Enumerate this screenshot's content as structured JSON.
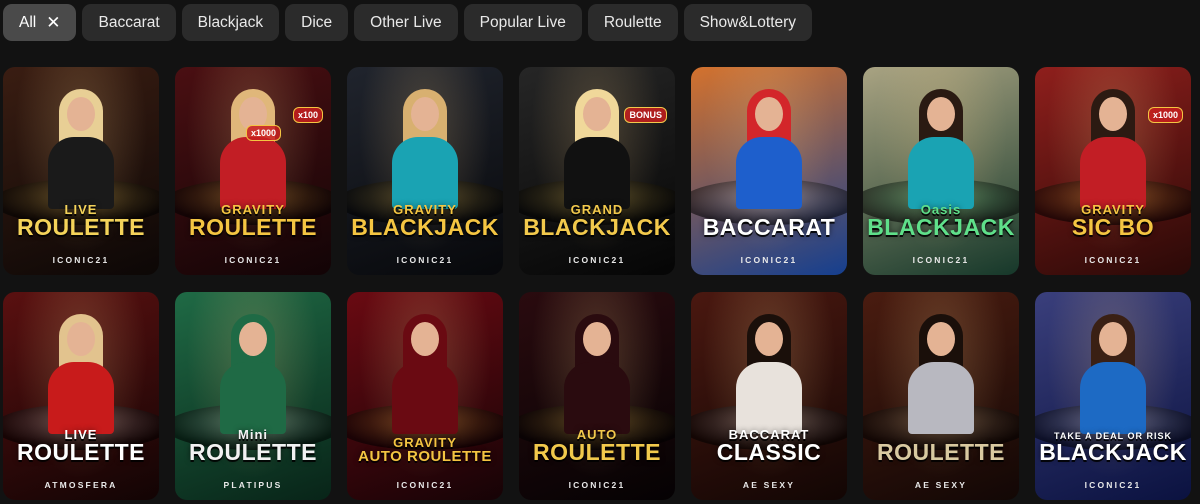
{
  "filters": [
    {
      "label": "All",
      "active": true
    },
    {
      "label": "Baccarat",
      "active": false
    },
    {
      "label": "Blackjack",
      "active": false
    },
    {
      "label": "Dice",
      "active": false
    },
    {
      "label": "Other Live",
      "active": false
    },
    {
      "label": "Popular Live",
      "active": false
    },
    {
      "label": "Roulette",
      "active": false
    },
    {
      "label": "Show&Lottery",
      "active": false
    }
  ],
  "games": [
    {
      "line1": "LIVE",
      "line2": "ROULETTE",
      "provider": "ICONIC21",
      "color1": "#3a1d12",
      "color2": "#0c0706",
      "accent": "#f4d35a",
      "hair": "#e8cf95",
      "body": "#1a1a1a"
    },
    {
      "line1": "GRAVITY",
      "line2": "ROULETTE",
      "provider": "ICONIC21",
      "color1": "#4a0f12",
      "color2": "#120406",
      "accent": "#f4c542",
      "hair": "#e0b77a",
      "body": "#c21e25",
      "badges": [
        "x100",
        "x1000"
      ]
    },
    {
      "line1": "GRAVITY",
      "line2": "BLACKJACK",
      "provider": "ICONIC21",
      "color1": "#20242d",
      "color2": "#07080b",
      "accent": "#f4c542",
      "hair": "#d8b070",
      "body": "#1aa3b3"
    },
    {
      "line1": "GRAND",
      "line2": "BLACKJACK",
      "provider": "ICONIC21",
      "color1": "#262626",
      "color2": "#050505",
      "accent": "#f2c94c",
      "hair": "#f0d89a",
      "body": "#111111",
      "badges": [
        "BONUS"
      ]
    },
    {
      "line1": "",
      "line2": "BACCARAT",
      "provider": "ICONIC21",
      "color1": "#d4722d",
      "color2": "#153f8f",
      "accent": "#ffffff",
      "hair": "#d3262a",
      "body": "#1e5fcc"
    },
    {
      "line1": "Oasis",
      "line2": "BLACKJACK",
      "provider": "ICONIC21",
      "color1": "#a9a382",
      "color2": "#16382a",
      "accent": "#5fe08a",
      "hair": "#2a1a12",
      "body": "#1aa3b3"
    },
    {
      "line1": "GRAVITY",
      "line2": "SIC BO",
      "provider": "ICONIC21",
      "color1": "#8f1f1c",
      "color2": "#2a0907",
      "accent": "#f4c542",
      "hair": "#2c1a12",
      "body": "#c21e25",
      "badges": [
        "x1000"
      ]
    },
    {
      "line1": "LIVE",
      "line2": "ROULETTE",
      "provider": "ATMOSFERA",
      "color1": "#5a1010",
      "color2": "#120404",
      "accent": "#ffffff",
      "hair": "#e2c38e",
      "body": "#c81b1b"
    },
    {
      "line1": "Mini",
      "line2": "ROULETTE",
      "provider": "PLATIPUS",
      "color1": "#1f6a45",
      "color2": "#082418",
      "accent": "#f2f2f2",
      "hair": "#1f6a45",
      "body": "#1f6a45"
    },
    {
      "line1": "GRAVITY",
      "line2": "AUTO ROULETTE",
      "provider": "ICONIC21",
      "color1": "#6a0a12",
      "color2": "#160306",
      "accent": "#f4c542",
      "hair": "#6a0a12",
      "body": "#6a0a12"
    },
    {
      "line1": "AUTO",
      "line2": "ROULETTE",
      "provider": "ICONIC21",
      "color1": "#2a0b0f",
      "color2": "#050203",
      "accent": "#f2c94c",
      "hair": "#2a0b0f",
      "body": "#2a0b0f"
    },
    {
      "line1": "BACCARAT",
      "line2": "CLASSIC",
      "provider": "AE SEXY",
      "color1": "#4a1810",
      "color2": "#120604",
      "accent": "#ffffff",
      "hair": "#1a0f0a",
      "body": "#e8e2dc"
    },
    {
      "line1": "",
      "line2": "ROULETTE",
      "provider": "AE SEXY",
      "color1": "#4a1c10",
      "color2": "#120705",
      "accent": "#d9c9a0",
      "hair": "#1a0f0a",
      "body": "#b8b8c0"
    },
    {
      "line1": "TAKE A DEAL OR RISK",
      "line2": "BLACKJACK",
      "provider": "ICONIC21",
      "color1": "#3a3f7c",
      "color2": "#0b1240",
      "accent": "#ffffff",
      "hair": "#3a2014",
      "body": "#1d6ac4"
    }
  ]
}
